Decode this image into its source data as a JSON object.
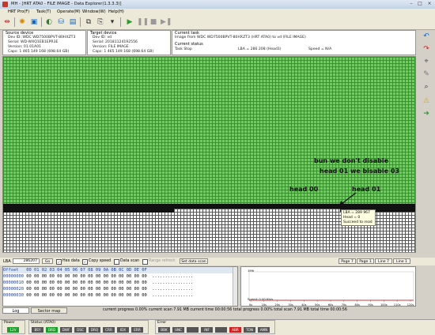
{
  "window": {
    "title": "MH - [HRT ATA0 - FILE IMAGE - Data Explorer(1.3.3.3)]"
  },
  "menu": [
    "HRT Pro(F)",
    "Task(T)",
    "Operate(M)",
    "Window(W)",
    "Help(H)"
  ],
  "source": {
    "title": "Source device",
    "dev_id": "Dev ID:  WDC WD7500BPVT-80HXZT3",
    "serial": "Serial:  WD-WXQ1EB1EPR3E",
    "version": "Version:  01.01A01",
    "caps": "Caps:  1 465 149 168 (698.64 GB)"
  },
  "target": {
    "title": "Target device",
    "dev_id": "Dev ID:  vd",
    "serial": "Serial:  20181124192556",
    "version": "Version:  FILE IMAGE",
    "caps": "Caps:  1 465 149 168 (698.64 GB)"
  },
  "current_task": {
    "title": "Current task",
    "text": "Image from WDC WD7500BPVT-80HXZT3 (HRT ATA0) to vd (FILE IMAGE)"
  },
  "current_status": {
    "title": "Current status",
    "task": "Task Stop",
    "lba": "LBA = 286 208 (Head1)",
    "speed": "Speed = N/A"
  },
  "annotations": {
    "line1": "bun we don't disable",
    "line2": "head 01 we bisable  03",
    "head00": "head 00",
    "head01": "head 01"
  },
  "tooltip": {
    "lba": "LBA = 289 967",
    "head": "Head = 0",
    "status": "Succeed to read"
  },
  "lba_bar": {
    "label": "LBA",
    "value": "286207",
    "go": "Go",
    "hex_data": "Hex data",
    "copy_speed": "Copy speed",
    "data_scan": "Data scan",
    "range_refresh": "Range refresh",
    "set_data_scan": "Set data scan",
    "page": "Page 7",
    "page1": "Page 1",
    "line": "Line 7",
    "line1": "Line 1"
  },
  "hex": {
    "header_offset": "Offset",
    "header_bytes": "00 01 02 03 04 05 06 07 08 09 0A 0B 0C 0D 0E 0F",
    "rows": [
      {
        "offset": "00000000",
        "bytes": "00 00 00 00 00 00 00 00 00 00 00 00 00 00 00 00",
        "ascii": "................"
      },
      {
        "offset": "00000010",
        "bytes": "00 00 00 00 00 00 00 00 00 00 00 00 00 00 00 00",
        "ascii": "................"
      },
      {
        "offset": "00000020",
        "bytes": "00 00 00 00 00 00 00 00 00 00 00 00 00 00 00 00",
        "ascii": "................"
      },
      {
        "offset": "00000030",
        "bytes": "00 00 00 00 00 00 00 00 00 00 00 00 00 00 00 00",
        "ascii": "................"
      }
    ]
  },
  "graph": {
    "top_label": "1Mb",
    "bottom_label": "Speed: 0.00 Kb/s",
    "xticks": [
      "0s",
      "10s",
      "20s",
      "30s",
      "40s",
      "50s",
      "60s",
      "70s",
      "80s",
      "90s",
      "100s",
      "110s",
      "120s"
    ]
  },
  "tabs": {
    "log": "Log",
    "sector_map": "Sector map"
  },
  "stats": {
    "text": "current progress  0.00%   current scan  7.91 MB   current time  00:00:56   total progress  0.00%   total scan  7.91 MB   total time  00:00:56"
  },
  "statusbar": {
    "power_label": "Power",
    "power_led": "12V",
    "status_label": "Status (ATA0)",
    "status_leds": [
      "BSY",
      "DRD",
      "DWF",
      "DSC",
      "DRQ",
      "CRR",
      "IDX",
      "ERR"
    ],
    "error_label": "Error",
    "error_leds": [
      "BBK",
      "UNC",
      "",
      "INF",
      "",
      "ABR",
      "TON",
      "AMN"
    ],
    "colors": {
      "on_green": "#1e9c2c",
      "on_red": "#cc2222",
      "off": "#666666"
    }
  }
}
